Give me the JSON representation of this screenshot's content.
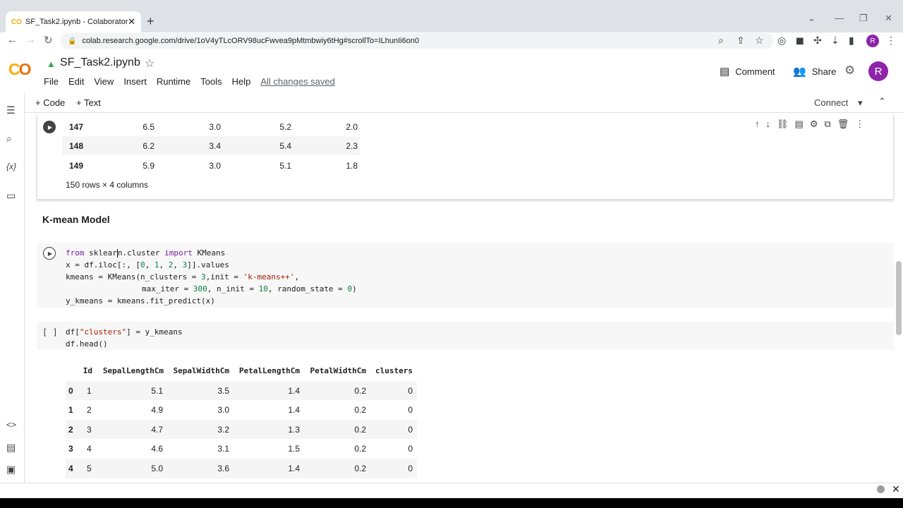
{
  "browser": {
    "tab_title": "SF_Task2.ipynb - Colaboratory",
    "tab_favicon": "CO",
    "url": "colab.research.google.com/drive/1oV4yTLcORV98ucFwvea9pMtmbwiy6tHg#scrollTo=ILhunIi6on0",
    "profile_initial": "R"
  },
  "colab": {
    "notebook_title": "SF_Task2.ipynb",
    "menu": [
      "File",
      "Edit",
      "View",
      "Insert",
      "Runtime",
      "Tools",
      "Help"
    ],
    "saved_status": "All changes saved",
    "comment_label": "Comment",
    "share_label": "Share",
    "avatar_initial": "R",
    "add_code_label": "+ Code",
    "add_text_label": "+ Text",
    "connect_label": "Connect"
  },
  "output_table_top": {
    "rows": [
      {
        "idx": "147",
        "c1": "6.5",
        "c2": "3.0",
        "c3": "5.2",
        "c4": "2.0"
      },
      {
        "idx": "148",
        "c1": "6.2",
        "c2": "3.4",
        "c3": "5.4",
        "c4": "2.3"
      },
      {
        "idx": "149",
        "c1": "5.9",
        "c2": "3.0",
        "c3": "5.1",
        "c4": "1.8"
      }
    ],
    "info": "150 rows × 4 columns"
  },
  "section_heading": "K-mean Model",
  "code_cell": {
    "line1_from": "from",
    "line1_mod_a": "sklear",
    "line1_mod_b": "n.cluster",
    "line1_import": "import",
    "line1_name": "KMeans",
    "line2_a": "x = df.iloc[",
    "line2_b": ":, [",
    "line2_n0": "0",
    "line2_n1": "1",
    "line2_n2": "2",
    "line2_n3": "3",
    "line2_c": "]].values",
    "line3_a": "kmeans = KMeans(n_clusters = ",
    "line3_n": "3",
    "line3_b": ",init = ",
    "line3_s": "'k-means++'",
    "line3_c": ",",
    "line4_a": "max_iter = ",
    "line4_n1": "300",
    "line4_b": ", n_init = ",
    "line4_n2": "10",
    "line4_c": ", random_state = ",
    "line4_n3": "0",
    "line4_d": ")",
    "line5": "y_kmeans = kmeans.fit_predict(x)"
  },
  "cell2": {
    "bracket": "[ ]",
    "line1_a": "df[",
    "line1_s": "\"clusters\"",
    "line1_b": "] = y_kmeans",
    "line2": "df.head()"
  },
  "head_table": {
    "columns": [
      "Id",
      "SepalLengthCm",
      "SepalWidthCm",
      "PetalLengthCm",
      "PetalWidthCm",
      "clusters"
    ],
    "rows": [
      {
        "idx": "0",
        "Id": "1",
        "SL": "5.1",
        "SW": "3.5",
        "PL": "1.4",
        "PW": "0.2",
        "cl": "0"
      },
      {
        "idx": "1",
        "Id": "2",
        "SL": "4.9",
        "SW": "3.0",
        "PL": "1.4",
        "PW": "0.2",
        "cl": "0"
      },
      {
        "idx": "2",
        "Id": "3",
        "SL": "4.7",
        "SW": "3.2",
        "PL": "1.3",
        "PW": "0.2",
        "cl": "0"
      },
      {
        "idx": "3",
        "Id": "4",
        "SL": "4.6",
        "SW": "3.1",
        "PL": "1.5",
        "PW": "0.2",
        "cl": "0"
      },
      {
        "idx": "4",
        "Id": "5",
        "SL": "5.0",
        "SW": "3.6",
        "PL": "1.4",
        "PW": "0.2",
        "cl": "0"
      }
    ]
  },
  "icons": {
    "drive": "google-drive-icon",
    "star": "star-icon",
    "comment": "comment-icon",
    "share": "share-people-icon",
    "gear": "gear-icon"
  }
}
